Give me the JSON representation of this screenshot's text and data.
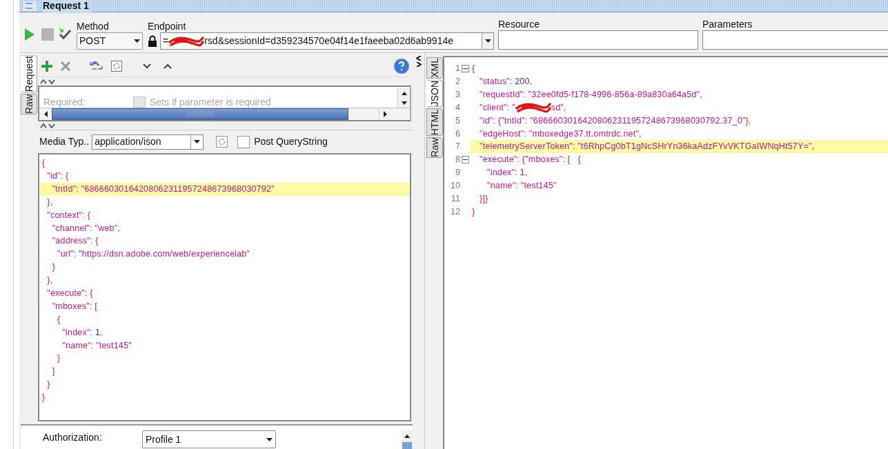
{
  "window": {
    "title": "Request 1"
  },
  "toolbar": {
    "method_label": "Method",
    "method": "POST",
    "endpoint_label": "Endpoint",
    "endpoint": [
      {
        "kind": "text",
        "text": "="
      },
      {
        "kind": "redaction"
      },
      {
        "kind": "text",
        "text": "rsd&sessionId=d359234570e04f14e1faeeba02d6ab9914e"
      }
    ],
    "resource_label": "Resource",
    "parameters_label": "Parameters"
  },
  "request_tabs": [
    {
      "label": "Request",
      "selected": true
    },
    {
      "label": "Raw",
      "selected": false
    }
  ],
  "params": {
    "label": "Required:",
    "checkbox_label": "Sets if parameter is required",
    "checked": false,
    "disabled": true
  },
  "media_type": {
    "label": "Media Typ..",
    "value": "application/ison",
    "post_querystring": {
      "label": "Post QueryString",
      "checked": false
    }
  },
  "request_body": [
    {
      "highlighted": false,
      "tokens": [
        {
          "kind": "punct",
          "text": "{"
        }
      ]
    },
    {
      "highlighted": false,
      "tokens": [
        {
          "kind": "key",
          "text": "  \"id\""
        },
        {
          "kind": "punct",
          "text": ": {"
        }
      ]
    },
    {
      "highlighted": true,
      "tokens": [
        {
          "kind": "key",
          "text": "    \"tntId\""
        },
        {
          "kind": "punct",
          "text": ": "
        },
        {
          "kind": "str",
          "text": "\"68666030164208062311957248673968030792\""
        }
      ]
    },
    {
      "highlighted": false,
      "tokens": [
        {
          "kind": "punct",
          "text": "  },"
        }
      ]
    },
    {
      "highlighted": false,
      "tokens": [
        {
          "kind": "key",
          "text": "  \"context\""
        },
        {
          "kind": "punct",
          "text": ": {"
        }
      ]
    },
    {
      "highlighted": false,
      "tokens": [
        {
          "kind": "key",
          "text": "    \"channel\""
        },
        {
          "kind": "punct",
          "text": ": "
        },
        {
          "kind": "str",
          "text": "\"web\""
        },
        {
          "kind": "punct",
          "text": ","
        }
      ]
    },
    {
      "highlighted": false,
      "tokens": [
        {
          "kind": "key",
          "text": "    \"address\""
        },
        {
          "kind": "punct",
          "text": ": {"
        }
      ]
    },
    {
      "highlighted": false,
      "tokens": [
        {
          "kind": "key",
          "text": "      \"url\""
        },
        {
          "kind": "punct",
          "text": ": "
        },
        {
          "kind": "str",
          "text": "\"https://dsn.adobe.com/web/experiencelab\""
        }
      ]
    },
    {
      "highlighted": false,
      "tokens": [
        {
          "kind": "punct",
          "text": "    }"
        }
      ]
    },
    {
      "highlighted": false,
      "tokens": [
        {
          "kind": "punct",
          "text": "  },"
        }
      ]
    },
    {
      "highlighted": false,
      "tokens": [
        {
          "kind": "key",
          "text": "  \"execute\""
        },
        {
          "kind": "punct",
          "text": ": {"
        }
      ]
    },
    {
      "highlighted": false,
      "tokens": [
        {
          "kind": "key",
          "text": "    \"mboxes\""
        },
        {
          "kind": "punct",
          "text": ": ["
        }
      ]
    },
    {
      "highlighted": false,
      "tokens": [
        {
          "kind": "punct",
          "text": "      {"
        }
      ]
    },
    {
      "highlighted": false,
      "tokens": [
        {
          "kind": "key",
          "text": "        \"index\""
        },
        {
          "kind": "punct",
          "text": ": "
        },
        {
          "kind": "num",
          "text": "1"
        },
        {
          "kind": "punct",
          "text": ","
        }
      ]
    },
    {
      "highlighted": false,
      "tokens": [
        {
          "kind": "key",
          "text": "        \"name\""
        },
        {
          "kind": "punct",
          "text": ": "
        },
        {
          "kind": "str",
          "text": "\"test145\""
        }
      ]
    },
    {
      "highlighted": false,
      "tokens": [
        {
          "kind": "punct",
          "text": "      }"
        }
      ]
    },
    {
      "highlighted": false,
      "tokens": [
        {
          "kind": "punct",
          "text": "    ]"
        }
      ]
    },
    {
      "highlighted": false,
      "tokens": [
        {
          "kind": "punct",
          "text": "  }"
        }
      ]
    },
    {
      "highlighted": false,
      "tokens": [
        {
          "kind": "punct",
          "text": "}"
        }
      ]
    }
  ],
  "authorization": {
    "label": "Authorization:",
    "value": "Profile 1"
  },
  "response_tabs": [
    {
      "label": "XML",
      "selected": false
    },
    {
      "label": "JSON",
      "selected": true
    },
    {
      "label": "HTML",
      "selected": false
    },
    {
      "label": "Raw",
      "selected": false
    }
  ],
  "response_body": [
    {
      "number": "1",
      "foldable": true,
      "highlighted": false,
      "tokens": [
        {
          "kind": "punct",
          "text": "{"
        }
      ]
    },
    {
      "number": "2",
      "foldable": false,
      "highlighted": false,
      "tokens": [
        {
          "kind": "key",
          "text": "   \"status\""
        },
        {
          "kind": "punct",
          "text": ": "
        },
        {
          "kind": "num",
          "text": "200"
        },
        {
          "kind": "punct",
          "text": ","
        }
      ]
    },
    {
      "number": "3",
      "foldable": false,
      "highlighted": false,
      "tokens": [
        {
          "kind": "key",
          "text": "   \"requestId\""
        },
        {
          "kind": "punct",
          "text": ": "
        },
        {
          "kind": "str",
          "text": "\"32ee0fd5-f178-4996-856a-89a830a64a5d\""
        },
        {
          "kind": "punct",
          "text": ","
        }
      ]
    },
    {
      "number": "4",
      "foldable": false,
      "highlighted": false,
      "tokens": [
        {
          "kind": "key",
          "text": "   \"client\""
        },
        {
          "kind": "punct",
          "text": ": "
        },
        {
          "kind": "str",
          "text": "\""
        },
        {
          "kind": "redaction"
        },
        {
          "kind": "str",
          "text": "sd\""
        },
        {
          "kind": "punct",
          "text": ","
        }
      ]
    },
    {
      "number": "5",
      "foldable": false,
      "highlighted": false,
      "tokens": [
        {
          "kind": "key",
          "text": "   \"id\""
        },
        {
          "kind": "punct",
          "text": ": {"
        },
        {
          "kind": "key",
          "text": "\"tntId\""
        },
        {
          "kind": "punct",
          "text": ": "
        },
        {
          "kind": "str",
          "text": "\"68666030164208062311957248673968030792.37_0\""
        },
        {
          "kind": "punct",
          "text": "},"
        }
      ]
    },
    {
      "number": "6",
      "foldable": false,
      "highlighted": false,
      "tokens": [
        {
          "kind": "key",
          "text": "   \"edgeHost\""
        },
        {
          "kind": "punct",
          "text": ": "
        },
        {
          "kind": "str",
          "text": "\"mboxedge37.tt.omtrdc.net\""
        },
        {
          "kind": "punct",
          "text": ","
        }
      ]
    },
    {
      "number": "7",
      "foldable": false,
      "highlighted": true,
      "tokens": [
        {
          "kind": "key",
          "text": "   \"telemetryServerToken\""
        },
        {
          "kind": "punct",
          "text": ": "
        },
        {
          "kind": "str",
          "text": "\"t6RhpCg0bT1gNcSHrYn36kaAdzFYvVKTGaIWNqHt57Y=\""
        },
        {
          "kind": "punct",
          "text": ","
        }
      ]
    },
    {
      "number": "8",
      "foldable": true,
      "highlighted": false,
      "tokens": [
        {
          "kind": "key",
          "text": "   \"execute\""
        },
        {
          "kind": "punct",
          "text": ": {"
        },
        {
          "kind": "key",
          "text": "\"mboxes\""
        },
        {
          "kind": "punct",
          "text": ": [   {"
        }
      ]
    },
    {
      "number": "9",
      "foldable": false,
      "highlighted": false,
      "tokens": [
        {
          "kind": "key",
          "text": "      \"index\""
        },
        {
          "kind": "punct",
          "text": ": "
        },
        {
          "kind": "num",
          "text": "1"
        },
        {
          "kind": "punct",
          "text": ","
        }
      ]
    },
    {
      "number": "10",
      "foldable": false,
      "highlighted": false,
      "tokens": [
        {
          "kind": "key",
          "text": "      \"name\""
        },
        {
          "kind": "punct",
          "text": ": "
        },
        {
          "kind": "str",
          "text": "\"test145\""
        }
      ]
    },
    {
      "number": "11",
      "foldable": false,
      "highlighted": false,
      "tokens": [
        {
          "kind": "punct",
          "text": "   }]}"
        }
      ]
    },
    {
      "number": "12",
      "foldable": false,
      "highlighted": false,
      "tokens": [
        {
          "kind": "punct",
          "text": "}"
        }
      ]
    }
  ]
}
